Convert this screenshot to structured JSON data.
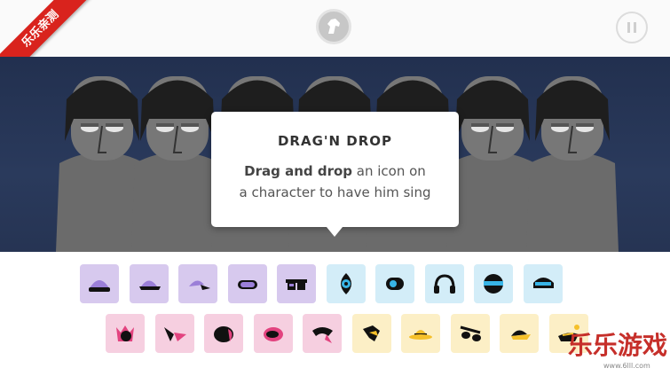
{
  "badge": {
    "text": "乐乐亲测"
  },
  "tooltip": {
    "title": "DRAG'N DROP",
    "line1_bold": "Drag and drop",
    "line1_rest": " an icon on",
    "line2": "a character to have him sing"
  },
  "watermark": {
    "text": "乐乐游戏",
    "url": "www.6lll.com"
  },
  "colors": {
    "purple": "#9b7fd8",
    "blue": "#38b4e6",
    "pink": "#e2437f",
    "yellow": "#f5c02a",
    "dark": "#111111"
  },
  "characters_count_visible": 7,
  "icons_row1": [
    {
      "group": "purple",
      "name": "beanie-icon"
    },
    {
      "group": "purple",
      "name": "cap-icon"
    },
    {
      "group": "purple",
      "name": "cap-side-icon"
    },
    {
      "group": "purple",
      "name": "goggles-icon"
    },
    {
      "group": "purple",
      "name": "sunglasses-icon"
    },
    {
      "group": "blue",
      "name": "eye-drop-icon"
    },
    {
      "group": "blue",
      "name": "speaker-icon"
    },
    {
      "group": "blue",
      "name": "headphones-icon"
    },
    {
      "group": "blue",
      "name": "helmet-icon"
    },
    {
      "group": "blue",
      "name": "visor-icon"
    }
  ],
  "icons_row2": [
    {
      "group": "pink",
      "name": "crown-icon"
    },
    {
      "group": "pink",
      "name": "wings-icon"
    },
    {
      "group": "pink",
      "name": "hat-pink-icon"
    },
    {
      "group": "pink",
      "name": "mask-icon"
    },
    {
      "group": "pink",
      "name": "hair-icon"
    },
    {
      "group": "yellow",
      "name": "hair-yellow-icon"
    },
    {
      "group": "yellow",
      "name": "fedora-icon"
    },
    {
      "group": "yellow",
      "name": "glasses-yellow-icon"
    },
    {
      "group": "yellow",
      "name": "cap-yellow-icon"
    },
    {
      "group": "yellow",
      "name": "shades-yellow-icon"
    }
  ]
}
